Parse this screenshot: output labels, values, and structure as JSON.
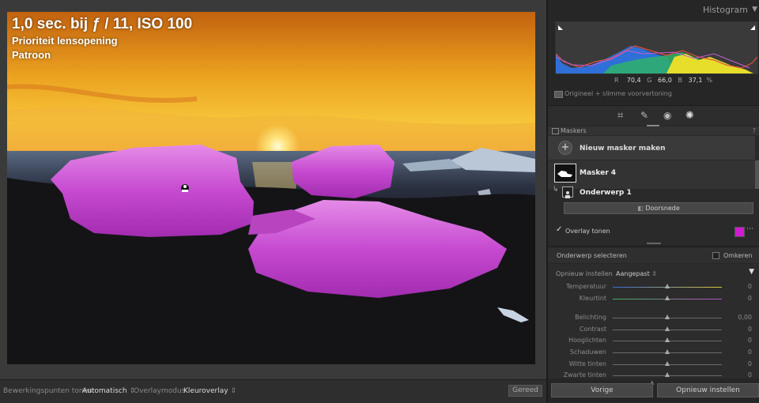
{
  "photo_overlay": {
    "exposure": "1,0 sec. bij ƒ / 11, ISO 100",
    "mode": "Prioriteit lensopening",
    "metering": "Patroon"
  },
  "bottom_bar": {
    "edit_pins_label": "Bewerkingspunten tonen:",
    "edit_pins_value": "Automatisch",
    "overlay_mode_label": "Overlaymodus",
    "overlay_mode_value": "Kleuroverlay",
    "done_button": "Gereed"
  },
  "histogram": {
    "title": "Histogram",
    "r_label": "R",
    "r_value": "70,4",
    "g_label": "G",
    "g_value": "66,0",
    "b_label": "B",
    "b_value": "37,1",
    "percent": "%",
    "preview_label": "Origineel + slimme voorvertoning"
  },
  "masks": {
    "title": "Maskers",
    "new_mask": "Nieuw masker maken",
    "mask_name": "Masker 4",
    "component_name": "Onderwerp 1",
    "intersect_button": "Doorsnede",
    "overlay_label": "Overlay tonen",
    "overlay_checked": true,
    "overlay_color": "#d11ad1"
  },
  "subject": {
    "select_label": "Onderwerp selecteren",
    "invert_label": "Omkeren"
  },
  "adjust": {
    "reset_label": "Opnieuw instellen",
    "preset_value": "Aangepast",
    "sliders": [
      {
        "label": "Temperatuur",
        "value": "0",
        "pos": 0.5
      },
      {
        "label": "Kleurtint",
        "value": "0",
        "pos": 0.5
      },
      {
        "label": "Belichting",
        "value": "0,00",
        "pos": 0.5
      },
      {
        "label": "Contrast",
        "value": "0",
        "pos": 0.5
      },
      {
        "label": "Hooglichten",
        "value": "0",
        "pos": 0.5
      },
      {
        "label": "Schaduwen",
        "value": "0",
        "pos": 0.5
      },
      {
        "label": "Witte tinten",
        "value": "0",
        "pos": 0.5
      },
      {
        "label": "Zwarte tinten",
        "value": "0",
        "pos": 0.5
      }
    ]
  },
  "footer": {
    "previous_button": "Vorige",
    "reset_button": "Opnieuw instellen"
  },
  "colors": {
    "mask_overlay": "#c93cd4",
    "sky_top": "#b8520e",
    "sky_mid": "#f0a21e"
  }
}
